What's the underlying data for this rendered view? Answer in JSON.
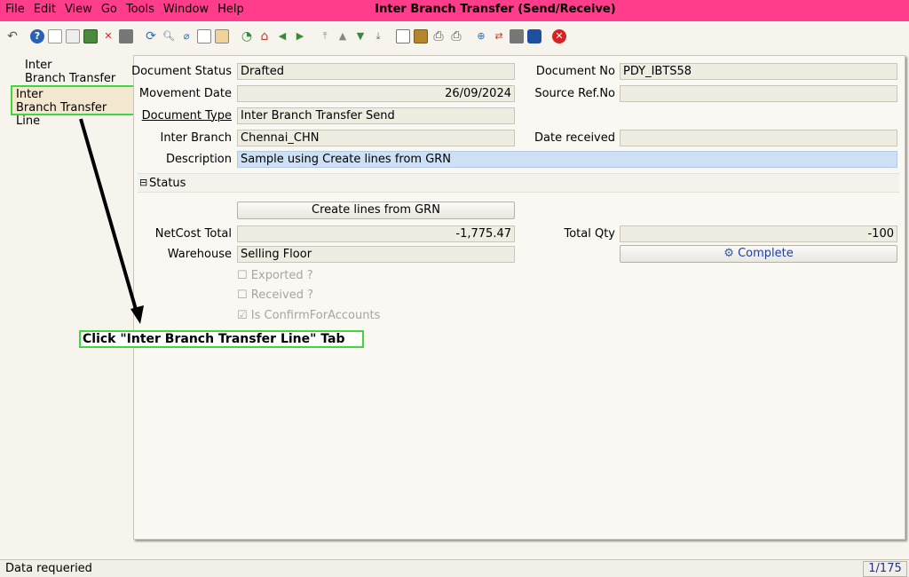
{
  "menu": [
    {
      "label": "File"
    },
    {
      "label": "Edit"
    },
    {
      "label": "View"
    },
    {
      "label": "Go"
    },
    {
      "label": "Tools"
    },
    {
      "label": "Window"
    },
    {
      "label": "Help"
    }
  ],
  "window_title": "Inter Branch Transfer (Send/Receive)",
  "tabs": [
    {
      "label_line1": "Inter",
      "label_line2": "Branch Transfer"
    },
    {
      "label_line1": "Inter",
      "label_line2": "Branch Transfer Line"
    }
  ],
  "form": {
    "document_status_label": "Document Status",
    "document_status": "Drafted",
    "document_no_label": "Document No",
    "document_no": "PDY_IBTS58",
    "movement_date_label": "Movement Date",
    "movement_date": "26/09/2024",
    "source_ref_label": "Source Ref.No",
    "source_ref": "",
    "document_type_label": "Document Type",
    "document_type": "Inter Branch Transfer Send",
    "inter_branch_label": "Inter Branch",
    "inter_branch": "Chennai_CHN",
    "date_received_label": "Date received",
    "date_received": "",
    "description_label": "Description",
    "description": "Sample using Create lines from GRN",
    "status_section_label": "Status",
    "create_lines_button": "Create lines from GRN",
    "netcost_total_label": "NetCost Total",
    "netcost_total": "-1,775.47",
    "total_qty_label": "Total Qty",
    "total_qty": "-100",
    "warehouse_label": "Warehouse",
    "warehouse": "Selling Floor",
    "complete_button": "Complete",
    "exported_label": "Exported ?",
    "received_label": "Received ?",
    "confirm_label": "Is ConfirmForAccounts"
  },
  "annotation": {
    "text": "Click \"Inter Branch Transfer Line\" Tab"
  },
  "statusbar": {
    "message": "Data requeried",
    "record_counter": "1/175"
  },
  "colors": {
    "titlebar": "#ff3d8b",
    "highlight": "#3fd63f",
    "description_field": "#cde0f5"
  }
}
